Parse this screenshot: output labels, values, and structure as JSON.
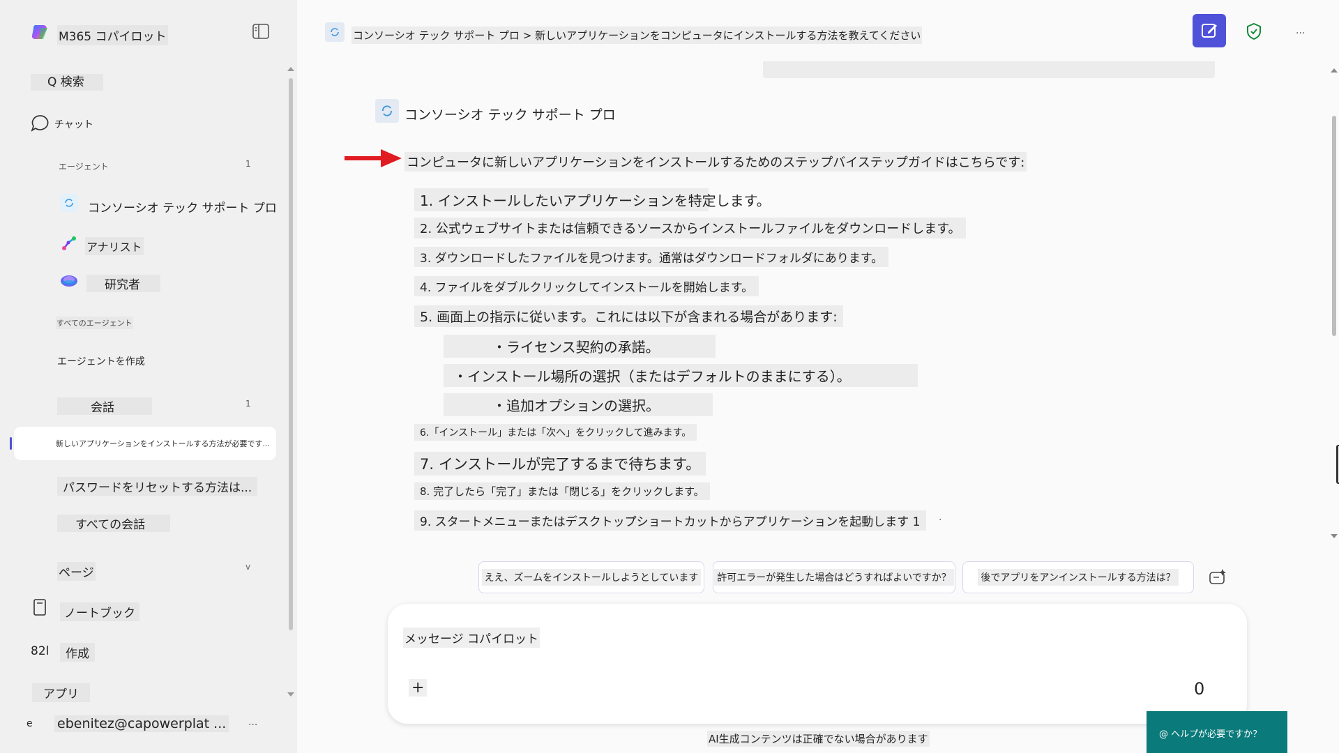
{
  "app": {
    "title": "M365 コパイロット"
  },
  "sidebar": {
    "search_label": "Q 検索",
    "chat_label": "チャット",
    "agents_label": "エージェント",
    "agents_count": "1",
    "agents": [
      {
        "label": "コンソーシオ テック サポート プロ"
      },
      {
        "label": "アナリスト"
      },
      {
        "label": "研究者"
      }
    ],
    "all_agents": "すべてのエージェント",
    "create_agent": "エージェントを作成",
    "conversations_label": "会話",
    "conversations_count": "1",
    "conversations": [
      {
        "label": "新しいアプリケーションをインストールする方法が必要です..."
      },
      {
        "label": "パスワードをリセットする方法は..."
      }
    ],
    "all_conversations": "すべての会話",
    "pages_label": "ページ",
    "pages_chevron": "v",
    "notebook_label": "ノートブック",
    "create_prefix": "82l",
    "create_label": "作成",
    "apps_label": "アプリ",
    "user_initial": "e",
    "user_email": "ebenitez@capowerplat ...",
    "user_more": "..."
  },
  "header": {
    "breadcrumb": "コンソーシオ テック サポート プロ > 新しいアプリケーションをコンピュータにインストールする方法を教えてください",
    "more": "..."
  },
  "chat": {
    "agent_name": "コンソーシオ テック サポート プロ",
    "intro": "コンピュータに新しいアプリケーションをインストールするためのステップバイステップガイドはこちらです:",
    "steps": [
      "1. インストールしたいアプリケーションを特定します。",
      "2. 公式ウェブサイトまたは信頼できるソースからインストールファイルをダウンロードします。",
      "3. ダウンロードしたファイルを見つけます。通常はダウンロードフォルダにあります。",
      "4. ファイルをダブルクリックしてインストールを開始します。",
      "5. 画面上の指示に従います。これには以下が含まれる場合があります:",
      "・ライセンス契約の承諾。",
      "・インストール場所の選択（またはデフォルトのままにする）。",
      "・追加オプションの選択。",
      "6.「インストール」または「次へ」をクリックして進みます。",
      "7. インストールが完了するまで待ちます。",
      "8. 完了したら「完了」または「閉じる」をクリックします。",
      "9. スタートメニューまたはデスクトップショートカットからアプリケーションを起動します 1"
    ],
    "step9_suffix": "."
  },
  "suggestions": [
    "ええ、ズームをインストールしようとしています",
    "許可エラーが発生した場合はどうすればよいですか？",
    "後でアプリをアンインストールする方法は？"
  ],
  "composer": {
    "placeholder": "メッセージ コパイロット",
    "plus": "+",
    "counter": "0"
  },
  "footer": {
    "disclaimer": "AI生成コンテンツは正確でない場合があります",
    "help": "@ ヘルプが必要ですか？"
  },
  "colors": {
    "accent": "#4f52d8",
    "arrow": "#e01b22",
    "shield": "#1a8a3c"
  }
}
